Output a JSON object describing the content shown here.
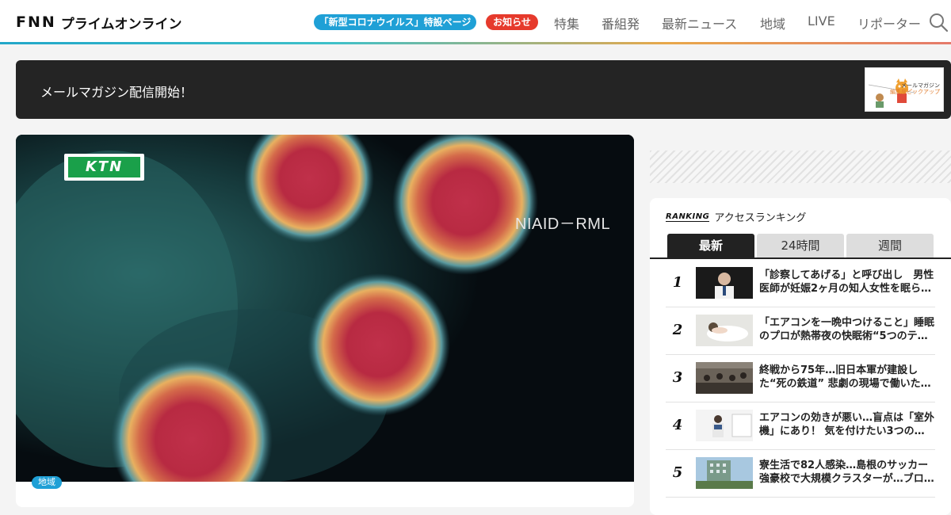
{
  "header": {
    "logo_fnn": "FNN",
    "logo_text": "プライムオンライン",
    "pill_covid": "「新型コロナウイルス」特設ページ",
    "pill_notice": "お知らせ",
    "nav": [
      "特集",
      "番組発",
      "最新ニュース",
      "地域",
      "LIVE",
      "リポーター"
    ],
    "search_icon": "search-icon"
  },
  "banner": {
    "text": "メールマガジン配信開始！",
    "thumb_line1": "メールマガジン",
    "thumb_line2": "編集部ピックアップ"
  },
  "article": {
    "station_logo": "KTN",
    "watermark": "NIAID－RML",
    "category": "地域"
  },
  "ranking": {
    "label_en": "RANKING",
    "label_jp": "アクセスランキング",
    "tabs": [
      "最新",
      "24時間",
      "週間"
    ],
    "active_tab": "最新",
    "items": [
      {
        "rank": "1",
        "title": "「診察してあげる」と呼び出し　男性医師が妊娠2ヶ月の知人女性を眠ら…"
      },
      {
        "rank": "2",
        "title": "「エアコンを一晩中つけること」睡眠のプロが熱帯夜の快眠術“5つのテ…"
      },
      {
        "rank": "3",
        "title": "終戦から75年…旧日本軍が建設した“死の鉄道” 悲劇の現場で働いた…"
      },
      {
        "rank": "4",
        "title": "エアコンの効きが悪い…盲点は「室外機」にあり！ 気を付けたい3つの…"
      },
      {
        "rank": "5",
        "title": "寮生活で82人感染…島根のサッカー強豪校で大規模クラスターが…ブロ…"
      }
    ]
  },
  "colors": {
    "accent_blue": "#1fa0d6",
    "accent_red": "#e63a2c",
    "ktn_green": "#1aa04a"
  }
}
